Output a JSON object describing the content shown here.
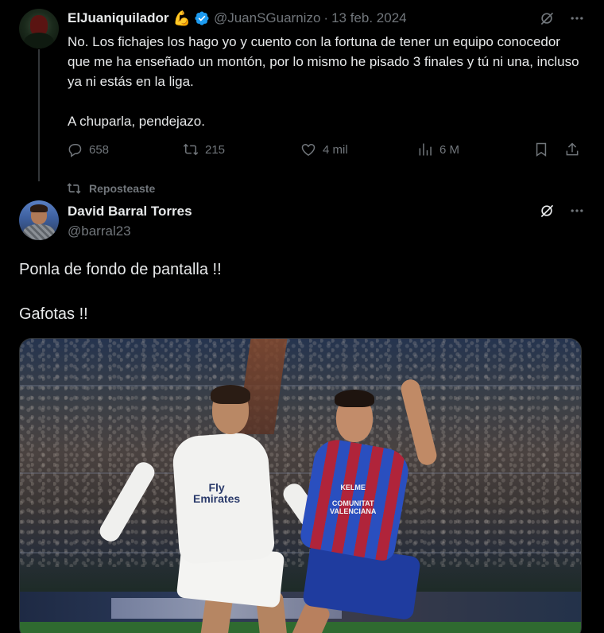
{
  "tweet1": {
    "display_name": "ElJuaniquilador",
    "name_emoji": "💪",
    "handle": "@JuanSGuarnizo",
    "separator": "·",
    "date": "13 feb. 2024",
    "paragraphs": [
      "No. Los fichajes los hago yo y cuento con la fortuna de tener un equipo conocedor que me ha enseñado un montón, por lo mismo he pisado 3 finales y tú ni una, incluso ya ni estás en la liga.",
      "A chuparla, pendejazo."
    ],
    "stats": {
      "replies": "658",
      "reposts": "215",
      "likes": "4 mil",
      "views": "6 M"
    }
  },
  "repost_label": "Reposteaste",
  "tweet2": {
    "display_name": "David Barral Torres",
    "handle": "@barral23",
    "paragraphs": [
      "Ponla de fondo de pantalla !!",
      "Gafotas !!"
    ],
    "image": {
      "jersey_sponsor_1": "Fly\nEmirates",
      "jersey_badge_2": "KELME\nCOMUNITAT\nVALENCIANA"
    }
  },
  "colors": {
    "background": "#000000",
    "text_primary": "#e7e9ea",
    "text_secondary": "#71767b",
    "verified_blue": "#1d9bf0"
  }
}
